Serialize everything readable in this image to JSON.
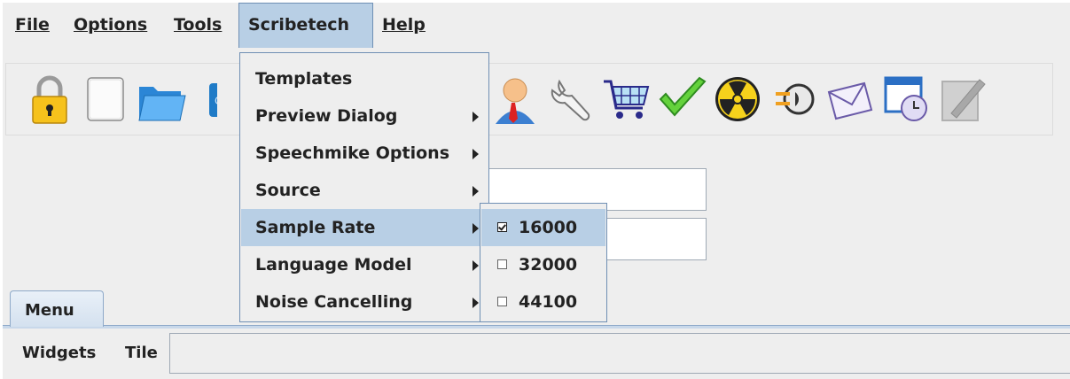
{
  "menubar": {
    "file": "File",
    "options": "Options",
    "tools": "Tools",
    "scribetech": "Scribetech",
    "help": "Help"
  },
  "toolbar": {
    "icons": [
      "lock-icon",
      "blank-page-icon",
      "folder-icon",
      "blue-ci-icon",
      "user-icon",
      "wrench-icon",
      "cart-icon",
      "checkmark-icon",
      "radiation-icon",
      "plug-icon",
      "envelope-icon",
      "window-clock-icon",
      "disabled-edit-icon"
    ]
  },
  "scribetech_menu": {
    "items": [
      {
        "label": "Templates",
        "has_submenu": false
      },
      {
        "label": "Preview Dialog",
        "has_submenu": true
      },
      {
        "label": "Speechmike Options",
        "has_submenu": true
      },
      {
        "label": "Source",
        "has_submenu": true
      },
      {
        "label": "Sample Rate",
        "has_submenu": true,
        "highlighted": true
      },
      {
        "label": "Language Model",
        "has_submenu": true
      },
      {
        "label": "Noise Cancelling",
        "has_submenu": true
      }
    ]
  },
  "sample_rate_submenu": {
    "items": [
      {
        "label": "16000",
        "checked": true
      },
      {
        "label": "32000",
        "checked": false
      },
      {
        "label": "44100",
        "checked": false
      }
    ]
  },
  "tabs": {
    "menu": "Menu"
  },
  "bottom": {
    "widgets": "Widgets",
    "tile": "Tile"
  },
  "colors": {
    "menu_highlight": "#b8cfe5",
    "menu_border": "#6f8fb4",
    "background": "#eeeeee"
  }
}
